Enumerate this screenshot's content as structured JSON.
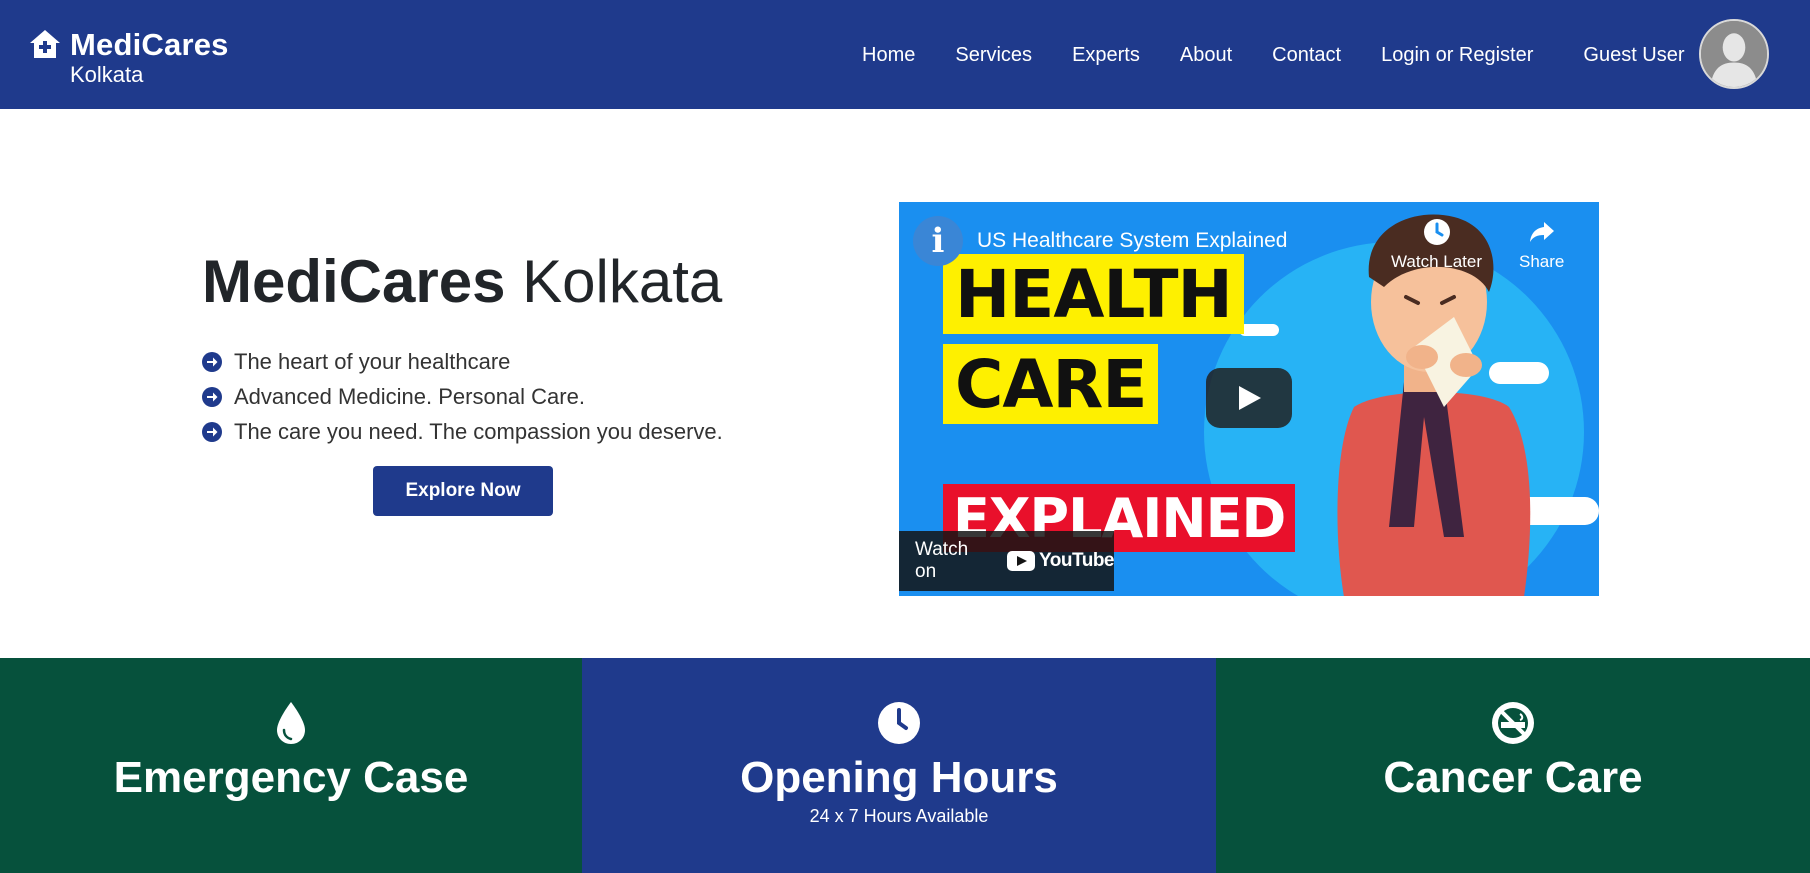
{
  "navbar": {
    "brand_name": "MediCares",
    "brand_city": "Kolkata",
    "links": [
      {
        "label": "Home"
      },
      {
        "label": "Services"
      },
      {
        "label": "Experts"
      },
      {
        "label": "About"
      },
      {
        "label": "Contact"
      },
      {
        "label": "Login or Register"
      },
      {
        "label": "Guest User"
      }
    ]
  },
  "hero": {
    "title_bold": "MediCares",
    "title_light": "Kolkata",
    "features": [
      "The heart of your healthcare",
      "Advanced Medicine. Personal Care.",
      "The care you need. The compassion you deserve."
    ],
    "cta_label": "Explore Now"
  },
  "video": {
    "title": "US Healthcare System Explained",
    "channel_initial": "i",
    "thumb_line_1": "HEALTH",
    "thumb_line_2": "CARE",
    "thumb_line_3": "EXPLAINED",
    "watch_later": "Watch Later",
    "share": "Share",
    "watch_on": "Watch on",
    "youtube": "YouTube"
  },
  "bands": [
    {
      "title": "Emergency Case",
      "subtitle": "",
      "icon": "droplet-icon",
      "color": "#06513c"
    },
    {
      "title": "Opening Hours",
      "subtitle": "24 x 7 Hours Available",
      "icon": "clock-icon",
      "color": "#1f3a8c"
    },
    {
      "title": "Cancer Care",
      "subtitle": "",
      "icon": "no-smoking-icon",
      "color": "#06513c"
    }
  ],
  "colors": {
    "primary": "#1f3a8c",
    "green": "#06513c",
    "yt_yellow": "#fef000",
    "yt_red": "#e9102b"
  }
}
